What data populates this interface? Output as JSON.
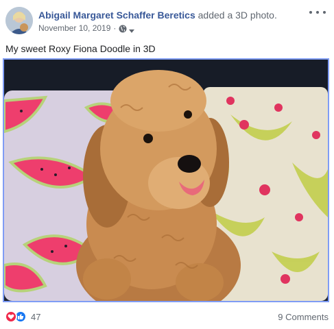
{
  "post": {
    "author": "Abigail Margaret Schaffer Beretics",
    "action": "added a 3D photo.",
    "date": "November 10, 2019",
    "separator": "·",
    "privacy_icon": "globe-icon",
    "caption": "My sweet Roxy Fiona Doodle in 3D"
  },
  "footer": {
    "reaction_count": "47",
    "comments": "9 Comments"
  },
  "colors": {
    "link": "#385898",
    "accent_border": "#7f9cf5",
    "love": "#f0284a",
    "like": "#1877f2",
    "muted_text": "#606770"
  }
}
